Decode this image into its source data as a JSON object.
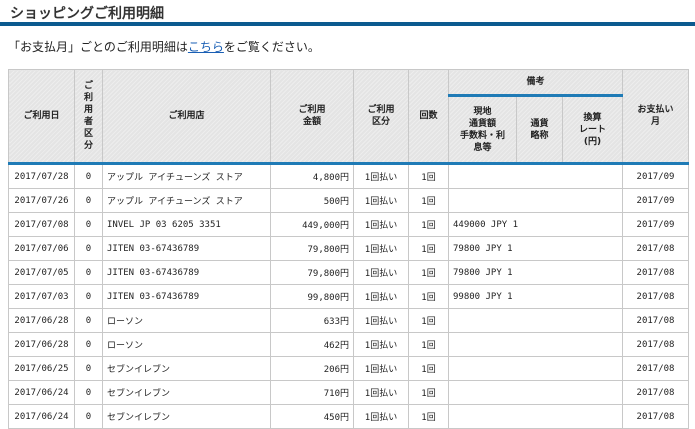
{
  "page": {
    "title": "ショッピングご利用明細",
    "intro_before": "「お支払月」ごとのご利用明細は",
    "intro_link": "こちら",
    "intro_after": "をご覧ください。"
  },
  "table": {
    "headers": {
      "date": "ご利用日",
      "user": "ご\n利\n用\n者\n区\n分",
      "store": "ご利用店",
      "amount": "ご利用\n金額",
      "method": "ご利用\n区分",
      "count": "回数",
      "remarks": "備考",
      "local": "現地\n通貨額\n手数料・利\n息等",
      "currency": "通貨\n略称",
      "rate": "換算\nレート\n(円)",
      "payment_month": "お支払い\n月"
    },
    "rows": [
      {
        "date": "2017/07/28",
        "user": "0",
        "store": "アップル アイチューンズ ストア",
        "amount": "4,800円",
        "method": "1回払い",
        "count": "1回",
        "local": "",
        "currency": "",
        "rate": "",
        "month": "2017/09"
      },
      {
        "date": "2017/07/26",
        "user": "0",
        "store": "アップル アイチューンズ ストア",
        "amount": "500円",
        "method": "1回払い",
        "count": "1回",
        "local": "",
        "currency": "",
        "rate": "",
        "month": "2017/09"
      },
      {
        "date": "2017/07/08",
        "user": "0",
        "store": "INVEL JP 03 6205 3351",
        "amount": "449,000円",
        "method": "1回払い",
        "count": "1回",
        "local": "449000 JPY 1",
        "currency": "",
        "rate": "",
        "month": "2017/09"
      },
      {
        "date": "2017/07/06",
        "user": "0",
        "store": "JITEN 03-67436789",
        "amount": "79,800円",
        "method": "1回払い",
        "count": "1回",
        "local": "79800 JPY 1",
        "currency": "",
        "rate": "",
        "month": "2017/08"
      },
      {
        "date": "2017/07/05",
        "user": "0",
        "store": "JITEN 03-67436789",
        "amount": "79,800円",
        "method": "1回払い",
        "count": "1回",
        "local": "79800 JPY 1",
        "currency": "",
        "rate": "",
        "month": "2017/08"
      },
      {
        "date": "2017/07/03",
        "user": "0",
        "store": "JITEN 03-67436789",
        "amount": "99,800円",
        "method": "1回払い",
        "count": "1回",
        "local": "99800 JPY 1",
        "currency": "",
        "rate": "",
        "month": "2017/08"
      },
      {
        "date": "2017/06/28",
        "user": "0",
        "store": "ローソン",
        "amount": "633円",
        "method": "1回払い",
        "count": "1回",
        "local": "",
        "currency": "",
        "rate": "",
        "month": "2017/08"
      },
      {
        "date": "2017/06/28",
        "user": "0",
        "store": "ローソン",
        "amount": "462円",
        "method": "1回払い",
        "count": "1回",
        "local": "",
        "currency": "",
        "rate": "",
        "month": "2017/08"
      },
      {
        "date": "2017/06/25",
        "user": "0",
        "store": "セブンイレブン",
        "amount": "206円",
        "method": "1回払い",
        "count": "1回",
        "local": "",
        "currency": "",
        "rate": "",
        "month": "2017/08"
      },
      {
        "date": "2017/06/24",
        "user": "0",
        "store": "セブンイレブン",
        "amount": "710円",
        "method": "1回払い",
        "count": "1回",
        "local": "",
        "currency": "",
        "rate": "",
        "month": "2017/08"
      },
      {
        "date": "2017/06/24",
        "user": "0",
        "store": "セブンイレブン",
        "amount": "450円",
        "method": "1回払い",
        "count": "1回",
        "local": "",
        "currency": "",
        "rate": "",
        "month": "2017/08"
      }
    ]
  }
}
